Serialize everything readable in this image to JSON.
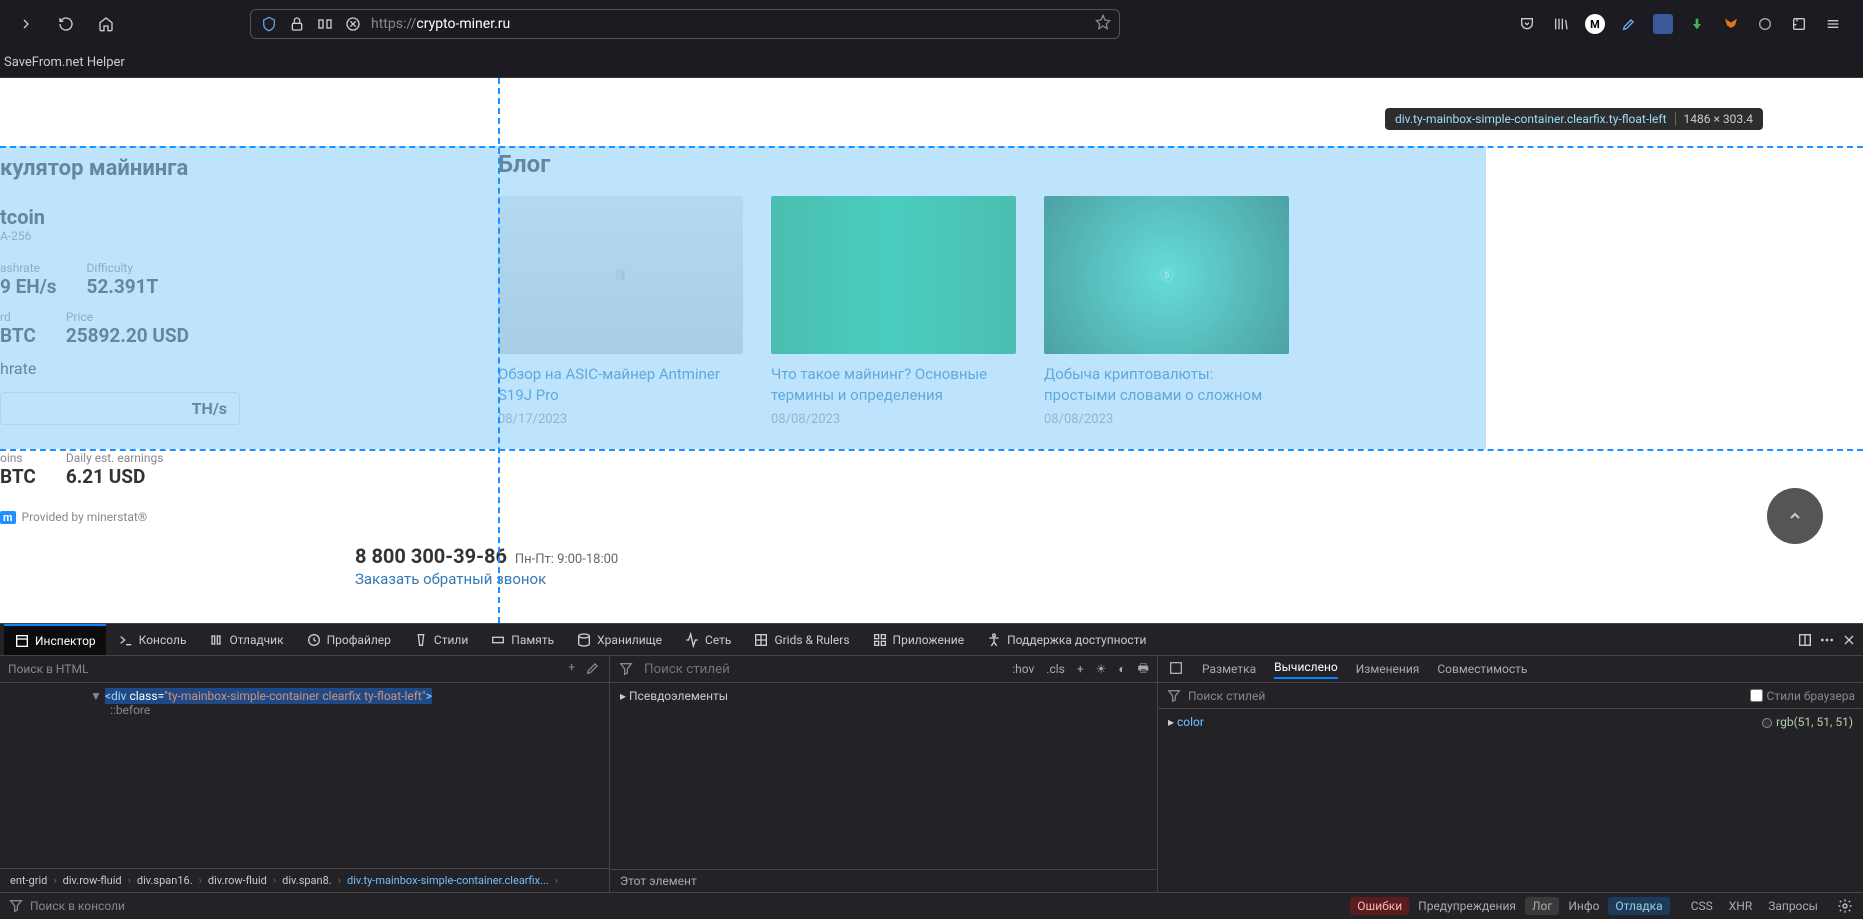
{
  "browser": {
    "url_scheme": "https://",
    "url_host": "crypto-miner.ru",
    "bookmark": "SaveFrom.net Helper"
  },
  "inspect_tooltip": {
    "selector": "div.ty-mainbox-simple-container.clearfix.ty-float-left",
    "dimensions": "1486 × 303.4"
  },
  "calc": {
    "heading": "кулятор майнинга",
    "coin": "tcoin",
    "algo": "A-256",
    "hashrate_lbl": "ashrate",
    "hashrate_val": "9 EH/s",
    "diff_lbl": "Difficulty",
    "diff_val": "52.391T",
    "rd_lbl": "rd",
    "rd_val": "BTC",
    "price_lbl": "Price",
    "price_val": "25892.20 USD",
    "hrate_lbl": "hrate",
    "hrate_unit": "TH/s",
    "coins_lbl": "oins",
    "coins_val": "BTC",
    "earn_lbl": "Daily est. earnings",
    "earn_val": "6.21 USD",
    "prov": "Provided by minerstat®",
    "prov_m": "m"
  },
  "blog": {
    "heading": "Блог",
    "cards": [
      {
        "title": "Обзор на ASIC-майнер Antminer S19J Pro",
        "date": "08/17/2023"
      },
      {
        "title": "Что такое майнинг? Основные термины и определения",
        "date": "08/08/2023"
      },
      {
        "title": "Добыча криптовалюты: простыми словами о сложном",
        "date": "08/08/2023"
      }
    ]
  },
  "phone": {
    "num": "8 800 300-39-86",
    "hours": "Пн-Пт: 9:00-18:00",
    "callback": "Заказать обратный звонок"
  },
  "devtools": {
    "tabs": [
      "Инспектор",
      "Консоль",
      "Отладчик",
      "Профайлер",
      "Стили",
      "Память",
      "Хранилище",
      "Сеть",
      "Grids & Rulers",
      "Приложение",
      "Поддержка доступности"
    ],
    "html_search_ph": "Поиск в HTML",
    "html_line": "<div class=\"ty-mainbox-simple-container clearfix ty-float-left\">",
    "html_pseudo": "::before",
    "breadcrumb": [
      "ent-grid",
      "div.row-fluid",
      "div.span16.",
      "div.row-fluid",
      "div.span8.",
      "div.ty-mainbox-simple-container.clearfix..."
    ],
    "styles_search_ph": "Поиск стилей",
    "styles_tools": {
      "hov": ":hov",
      "cls": ".cls"
    },
    "pseudoel": "Псевдоэлементы",
    "this_el": "Этот элемент",
    "rtabs": [
      "Разметка",
      "Вычислено",
      "Изменения",
      "Совместимость"
    ],
    "rsearch_ph": "Поиск стилей",
    "browser_styles": "Стили браузера",
    "color_prop": "color",
    "color_val": "rgb(51, 51, 51)",
    "console_ph": "Поиск в консоли",
    "filters": [
      "Ошибки",
      "Предупреждения",
      "Лог",
      "Инфо",
      "Отладка",
      "CSS",
      "XHR",
      "Запросы"
    ]
  }
}
